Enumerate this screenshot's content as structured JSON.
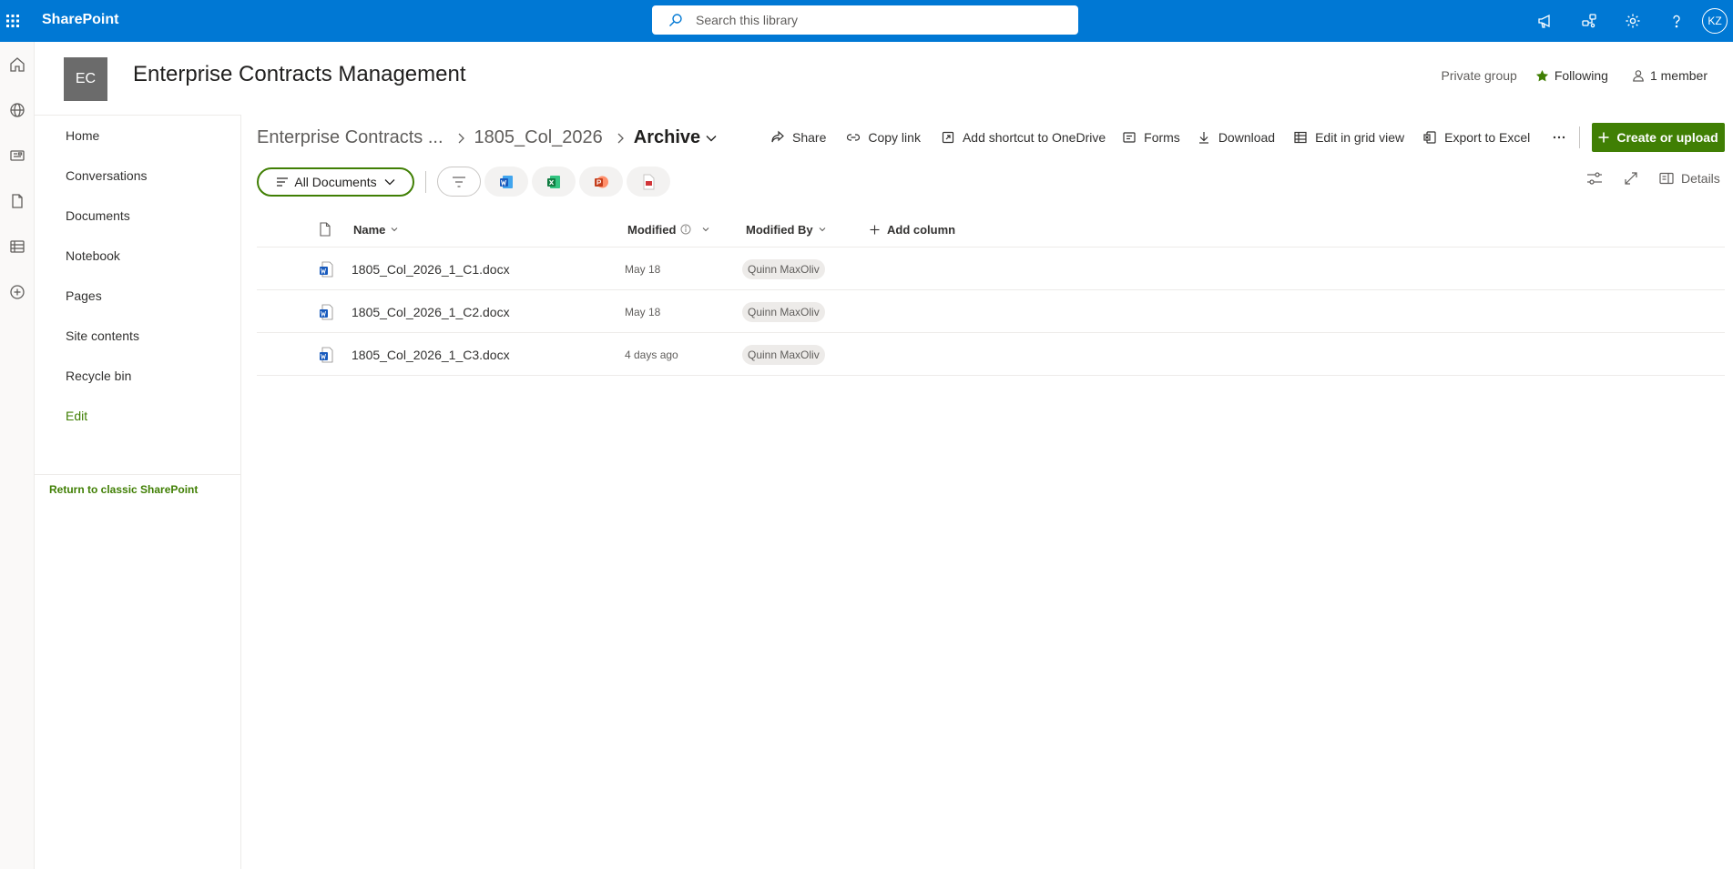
{
  "suite": {
    "app_name": "SharePoint",
    "search_placeholder": "Search this library",
    "user_initials": "KZ"
  },
  "site": {
    "logo_initials": "EC",
    "title": "Enterprise Contracts Management",
    "privacy": "Private group",
    "following_label": "Following",
    "members_label": "1 member"
  },
  "nav": {
    "items": [
      "Home",
      "Conversations",
      "Documents",
      "Notebook",
      "Pages",
      "Site contents",
      "Recycle bin"
    ],
    "edit_label": "Edit",
    "return_classic": "Return to classic SharePoint"
  },
  "breadcrumb": {
    "site": "Enterprise Contracts ...",
    "folder": "1805_Col_2026",
    "current": "Archive"
  },
  "commands": {
    "share": "Share",
    "copy_link": "Copy link",
    "add_shortcut": "Add shortcut to OneDrive",
    "forms": "Forms",
    "download": "Download",
    "edit_grid": "Edit in grid view",
    "export_excel": "Export to Excel",
    "create_upload": "Create or upload"
  },
  "view": {
    "current_view": "All Documents",
    "details_label": "Details"
  },
  "columns": {
    "name": "Name",
    "modified": "Modified",
    "modified_by": "Modified By",
    "add_column": "Add column"
  },
  "files": [
    {
      "name": "1805_Col_2026_1_C1.docx",
      "modified": "May 18",
      "modified_by": "Quinn MaxOliv"
    },
    {
      "name": "1805_Col_2026_1_C2.docx",
      "modified": "May 18",
      "modified_by": "Quinn MaxOliv"
    },
    {
      "name": "1805_Col_2026_1_C3.docx",
      "modified": "4 days ago",
      "modified_by": "Quinn MaxOliv"
    }
  ],
  "colors": {
    "suite_bar": "#0078d4",
    "accent_green": "#407f04",
    "word_blue": "#185abd",
    "excel_green": "#107c41",
    "powerpoint_red": "#c43e1c"
  }
}
